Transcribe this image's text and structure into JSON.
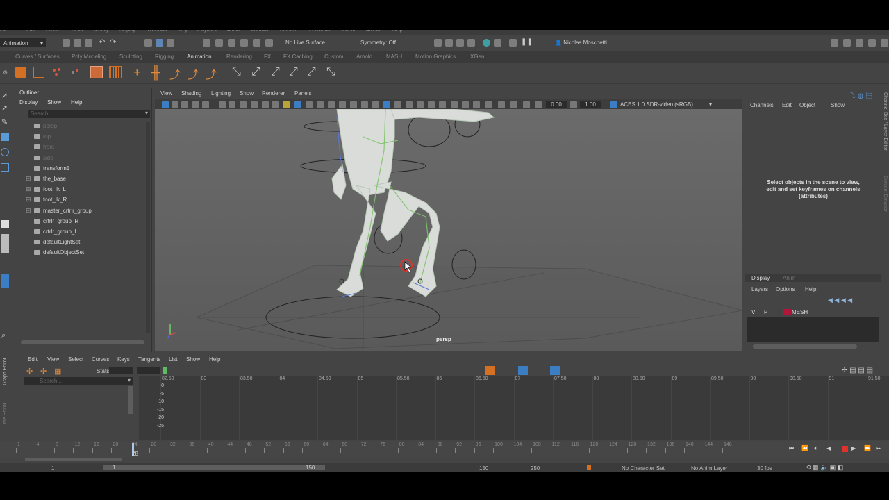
{
  "menubar": {
    "items": [
      "File",
      "Edit",
      "Create",
      "Select",
      "Modify",
      "Display",
      "Windows",
      "Key",
      "Playback",
      "Audio",
      "Visualize",
      "Deform",
      "Constrain",
      "Cache",
      "Arnold",
      "Help"
    ]
  },
  "statusline": {
    "mode": "Animation",
    "live_surface": "No Live Surface",
    "symmetry": "Symmetry: Off",
    "user": "Nicolas Moschetti"
  },
  "shelf_tabs": {
    "items": [
      "Curves / Surfaces",
      "Poly Modeling",
      "Sculpting",
      "Rigging",
      "Animation",
      "Rendering",
      "FX",
      "FX Caching",
      "Custom",
      "Arnold",
      "MASH",
      "Motion Graphics",
      "XGen"
    ],
    "active": "Animation"
  },
  "outliner": {
    "title": "Outliner",
    "menu": [
      "Display",
      "Show",
      "Help"
    ],
    "search_placeholder": "Search...",
    "items": [
      {
        "label": "persp",
        "expandable": false,
        "dim": true
      },
      {
        "label": "top",
        "expandable": false,
        "dim": true
      },
      {
        "label": "front",
        "expandable": false,
        "dim": true
      },
      {
        "label": "side",
        "expandable": false,
        "dim": true
      },
      {
        "label": "transform1",
        "expandable": false,
        "dim": false
      },
      {
        "label": "the_base",
        "expandable": true,
        "dim": false
      },
      {
        "label": "foot_Ik_L",
        "expandable": true,
        "dim": false
      },
      {
        "label": "foot_Ik_R",
        "expandable": true,
        "dim": false
      },
      {
        "label": "master_crtrlr_group",
        "expandable": true,
        "dim": false
      },
      {
        "label": "crtrlr_group_R",
        "expandable": false,
        "dim": false
      },
      {
        "label": "crtrlr_group_L",
        "expandable": false,
        "dim": false
      },
      {
        "label": "defaultLightSet",
        "expandable": false,
        "dim": false
      },
      {
        "label": "defaultObjectSet",
        "expandable": false,
        "dim": false
      }
    ]
  },
  "viewport": {
    "menu": [
      "View",
      "Shading",
      "Lighting",
      "Show",
      "Renderer",
      "Panels"
    ],
    "exposure": "0.00",
    "gamma": "1.00",
    "color_space": "ACES 1.0 SDR-video (sRGB)",
    "camera_label": "persp"
  },
  "channelbox": {
    "menu": [
      "Channels",
      "Edit",
      "Object",
      "Show"
    ],
    "message": "Select objects in the scene to view, edit and set keyframes on channels (attributes)",
    "side_tab": "Channel Box / Layer Editor",
    "side_tab2": "Content Browser",
    "layer_tabs": [
      "Display",
      "Anim"
    ],
    "layer_menu": [
      "Layers",
      "Options",
      "Help"
    ],
    "layer": {
      "v": "V",
      "p": "P",
      "name": "MESH",
      "color": "#b0163a"
    }
  },
  "graph_editor": {
    "side_label": "Graph Editor",
    "side_label2": "Time Editor",
    "menu": [
      "Edit",
      "View",
      "Select",
      "Curves",
      "Keys",
      "Tangents",
      "List",
      "Show",
      "Help"
    ],
    "stats_label": "Stats",
    "search_placeholder": "Search...",
    "time_ticks": [
      "82.50",
      "83",
      "83.50",
      "84",
      "84.50",
      "85",
      "85.50",
      "86",
      "86.50",
      "87",
      "87.50",
      "88",
      "88.50",
      "89",
      "89.50",
      "90",
      "90.50",
      "91",
      "91.50"
    ],
    "value_ticks": [
      "0",
      "-5",
      "-10",
      "-15",
      "-20",
      "-25"
    ]
  },
  "timeslider": {
    "ticks": [
      "1",
      "4",
      "8",
      "12",
      "16",
      "20",
      "24",
      "28",
      "32",
      "36",
      "40",
      "44",
      "48",
      "52",
      "56",
      "60",
      "64",
      "68",
      "72",
      "76",
      "80",
      "84",
      "88",
      "92",
      "96",
      "100",
      "104",
      "108",
      "112",
      "116",
      "120",
      "124",
      "128",
      "132",
      "136",
      "140",
      "144",
      "148"
    ],
    "current_frame": "28",
    "range_start": "1",
    "range_inner_start": "1",
    "range_inner_end": "150",
    "range_end_a": "150",
    "range_end_b": "250",
    "character_set": "No Character Set",
    "anim_layer": "No Anim Layer",
    "fps": "30 fps"
  }
}
